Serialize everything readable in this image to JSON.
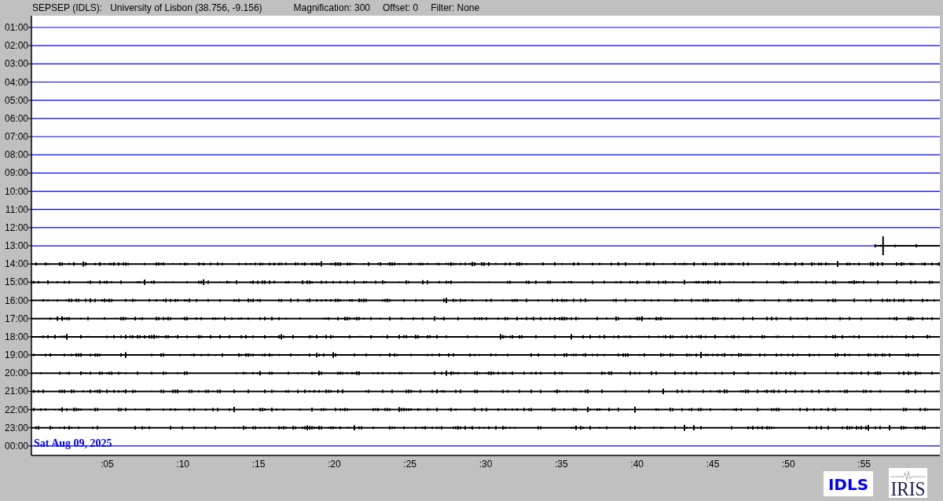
{
  "header": {
    "station": "SEPSEP (IDLS):",
    "location": "University of Lisbon (38.756, -9.156)",
    "magnification": "Magnification: 300",
    "offset": "Offset: 0",
    "filter": "Filter: None"
  },
  "rows": [
    {
      "label": "01:00",
      "kind": "empty"
    },
    {
      "label": "02:00",
      "kind": "empty"
    },
    {
      "label": "03:00",
      "kind": "empty"
    },
    {
      "label": "04:00",
      "kind": "empty"
    },
    {
      "label": "05:00",
      "kind": "empty"
    },
    {
      "label": "06:00",
      "kind": "empty"
    },
    {
      "label": "07:00",
      "kind": "empty"
    },
    {
      "label": "08:00",
      "kind": "empty"
    },
    {
      "label": "09:00",
      "kind": "empty"
    },
    {
      "label": "10:00",
      "kind": "empty"
    },
    {
      "label": "11:00",
      "kind": "empty"
    },
    {
      "label": "12:00",
      "kind": "empty"
    },
    {
      "label": "13:00",
      "kind": "partial"
    },
    {
      "label": "14:00",
      "kind": "recorded"
    },
    {
      "label": "15:00",
      "kind": "recorded"
    },
    {
      "label": "16:00",
      "kind": "recorded"
    },
    {
      "label": "17:00",
      "kind": "recorded"
    },
    {
      "label": "18:00",
      "kind": "recorded"
    },
    {
      "label": "19:00",
      "kind": "recorded"
    },
    {
      "label": "20:00",
      "kind": "recorded"
    },
    {
      "label": "21:00",
      "kind": "recorded"
    },
    {
      "label": "22:00",
      "kind": "recorded"
    },
    {
      "label": "23:00",
      "kind": "recorded"
    },
    {
      "label": "00:00",
      "kind": "empty"
    }
  ],
  "date": "Sat Aug 09, 2025",
  "x_ticks": [
    ":05",
    ":10",
    ":15",
    ":20",
    ":25",
    ":30",
    ":35",
    ":40",
    ":45",
    ":50",
    ":55"
  ],
  "logos": {
    "station": "IDLS",
    "network": "IRIS"
  }
}
